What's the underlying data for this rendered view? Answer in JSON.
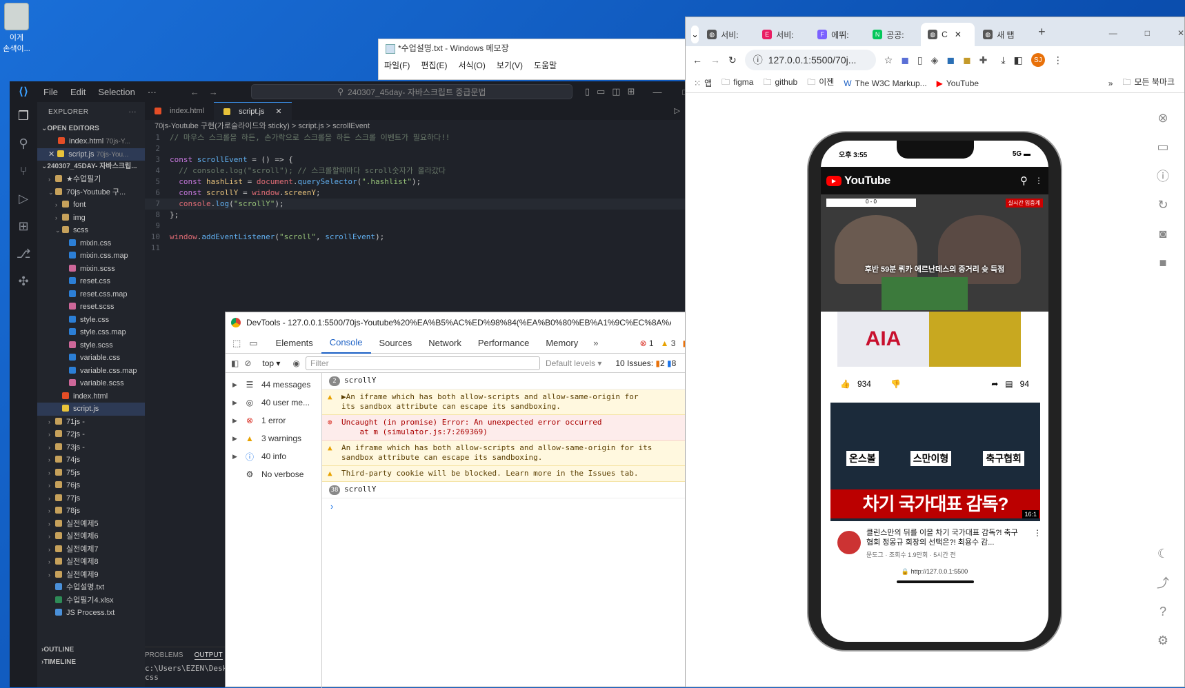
{
  "desktop": {
    "icon_label_1": "이게",
    "icon_label_2": "손색이..."
  },
  "notepad": {
    "title": "*수업설명.txt - Windows 메모장",
    "menu": [
      "파일(F)",
      "편집(E)",
      "서식(O)",
      "보기(V)",
      "도움말"
    ]
  },
  "vscode": {
    "menu": [
      "File",
      "Edit",
      "Selection",
      "···"
    ],
    "search": "240307_45day- 자바스크립트 중급문법",
    "explorer_label": "EXPLORER",
    "open_editors_label": "OPEN EDITORS",
    "open_editors": [
      {
        "name": "index.html",
        "path": "70js-Y..."
      },
      {
        "name": "script.js",
        "path": "70js-You..."
      }
    ],
    "workspace_label": "240307_45DAY- 자바스크립...",
    "tree": [
      {
        "label": "★수업필기",
        "indent": 1,
        "type": "folder"
      },
      {
        "label": "70js-Youtube 구...",
        "indent": 1,
        "type": "folder-open"
      },
      {
        "label": "font",
        "indent": 2,
        "type": "folder"
      },
      {
        "label": "img",
        "indent": 2,
        "type": "folder"
      },
      {
        "label": "scss",
        "indent": 2,
        "type": "folder-open"
      },
      {
        "label": "mixin.css",
        "indent": 3,
        "type": "css"
      },
      {
        "label": "mixin.css.map",
        "indent": 3,
        "type": "css"
      },
      {
        "label": "mixin.scss",
        "indent": 3,
        "type": "scss"
      },
      {
        "label": "reset.css",
        "indent": 3,
        "type": "css"
      },
      {
        "label": "reset.css.map",
        "indent": 3,
        "type": "css"
      },
      {
        "label": "reset.scss",
        "indent": 3,
        "type": "scss"
      },
      {
        "label": "style.css",
        "indent": 3,
        "type": "css"
      },
      {
        "label": "style.css.map",
        "indent": 3,
        "type": "css"
      },
      {
        "label": "style.scss",
        "indent": 3,
        "type": "scss"
      },
      {
        "label": "variable.css",
        "indent": 3,
        "type": "css"
      },
      {
        "label": "variable.css.map",
        "indent": 3,
        "type": "css"
      },
      {
        "label": "variable.scss",
        "indent": 3,
        "type": "scss"
      },
      {
        "label": "index.html",
        "indent": 2,
        "type": "html"
      },
      {
        "label": "script.js",
        "indent": 2,
        "type": "js"
      },
      {
        "label": "71js -",
        "indent": 1,
        "type": "folder"
      },
      {
        "label": "72js -",
        "indent": 1,
        "type": "folder"
      },
      {
        "label": "73js -",
        "indent": 1,
        "type": "folder"
      },
      {
        "label": "74js",
        "indent": 1,
        "type": "folder"
      },
      {
        "label": "75js",
        "indent": 1,
        "type": "folder"
      },
      {
        "label": "76js",
        "indent": 1,
        "type": "folder"
      },
      {
        "label": "77js",
        "indent": 1,
        "type": "folder"
      },
      {
        "label": "78js",
        "indent": 1,
        "type": "folder"
      },
      {
        "label": "실전예제5",
        "indent": 1,
        "type": "folder"
      },
      {
        "label": "실전예제6",
        "indent": 1,
        "type": "folder"
      },
      {
        "label": "실전예제7",
        "indent": 1,
        "type": "folder"
      },
      {
        "label": "실전예제8",
        "indent": 1,
        "type": "folder"
      },
      {
        "label": "실전예제9",
        "indent": 1,
        "type": "folder"
      },
      {
        "label": "수업설명.txt",
        "indent": 1,
        "type": "txt"
      },
      {
        "label": "수업필기4.xlsx",
        "indent": 1,
        "type": "xlsx"
      },
      {
        "label": "JS Process.txt",
        "indent": 1,
        "type": "txt"
      }
    ],
    "outline_label": "OUTLINE",
    "timeline_label": "TIMELINE",
    "tabs": [
      {
        "label": "index.html"
      },
      {
        "label": "script.js"
      }
    ],
    "breadcrumb": "70js-Youtube 구현(가로슬라이드와 sticky) > script.js > scrollEvent",
    "code": [
      {
        "n": "1",
        "html": "<span class='c-cm'>// 마우스 스크롤을 하든, 손가락으로 스크롤을 하든 스크롤 이벤트가 필요하다!!</span>"
      },
      {
        "n": "2",
        "html": ""
      },
      {
        "n": "3",
        "html": "<span class='c-kw'>const</span> <span class='c-fn'>scrollEvent</span> <span class='c-tx'>= () =&gt; {</span>"
      },
      {
        "n": "4",
        "html": "  <span class='c-cm'>// console.log(\"scroll\"); // 스크롤할때마다 scroll숫자가 올라갔다</span>"
      },
      {
        "n": "5",
        "html": "  <span class='c-kw'>const</span> <span class='c-vr'>hashList</span> <span class='c-tx'>= </span><span class='c-id'>document</span><span class='c-tx'>.</span><span class='c-fn'>querySelector</span><span class='c-tx'>(</span><span class='c-st'>\".hashlist\"</span><span class='c-tx'>);</span>"
      },
      {
        "n": "6",
        "html": "  <span class='c-kw'>const</span> <span class='c-vr'>scrollY</span> <span class='c-tx'>= </span><span class='c-id'>window</span><span class='c-tx'>.</span><span class='c-vr'>screenY</span><span class='c-tx'>;</span>"
      },
      {
        "n": "7",
        "html": "  <span class='c-id'>console</span><span class='c-tx'>.</span><span class='c-fn'>log</span><span class='c-tx'>(</span><span class='c-st'>\"scrollY\"</span><span class='c-tx'>);</span>"
      },
      {
        "n": "8",
        "html": "<span class='c-tx'>};</span>"
      },
      {
        "n": "9",
        "html": ""
      },
      {
        "n": "10",
        "html": "<span class='c-id'>window</span><span class='c-tx'>.</span><span class='c-fn'>addEventListener</span><span class='c-tx'>(</span><span class='c-st'>\"scroll\"</span><span class='c-tx'>, </span><span class='c-fn'>scrollEvent</span><span class='c-tx'>);</span>"
      },
      {
        "n": "11",
        "html": ""
      }
    ],
    "panel_tabs": [
      "PROBLEMS",
      "OUTPUT"
    ],
    "panel_path": "c:\\Users\\EZEN\\Desk",
    "panel_text": "css"
  },
  "devtools": {
    "title": "DevTools - 127.0.0.1:5500/70js-Youtube%20%EA%B5%AC%ED%98%84(%EA%B0%80%EB%A1%9C%EC%8A%AC%EB%...",
    "tabs": [
      "Elements",
      "Console",
      "Sources",
      "Network",
      "Performance",
      "Memory"
    ],
    "counts": {
      "errors": "1",
      "warnings": "3",
      "issues": "2"
    },
    "context": "top",
    "filter_placeholder": "Filter",
    "levels": "Default levels",
    "issues_label": "10 Issues:",
    "issues_a": "2",
    "issues_b": "8",
    "side": [
      {
        "label": "44 messages",
        "icon": "list-icon"
      },
      {
        "label": "40 user me...",
        "icon": "user-icon"
      },
      {
        "label": "1 error",
        "icon": "error-icon"
      },
      {
        "label": "3 warnings",
        "icon": "warning-icon"
      },
      {
        "label": "40 info",
        "icon": "info-icon"
      },
      {
        "label": "No verbose",
        "icon": "bug-icon"
      }
    ],
    "messages": [
      {
        "kind": "log",
        "count": "2",
        "text": "scrollY",
        "src": "script.js:7",
        "link": false
      },
      {
        "kind": "w",
        "text": "▶An iframe which has both allow-scripts and allow-same-origin for\nits sandbox attribute can escape its sandboxing.",
        "src": "simulator.js:7",
        "link": true
      },
      {
        "kind": "e",
        "text": "Uncaught (in promise) Error: An unexpected error occurred\n    at m (simulator.js:7:269369)",
        "src": "simulator.js:7",
        "link": false
      },
      {
        "kind": "w",
        "text": "An iframe which has both allow-scripts and allow-same-origin for its\nsandbox attribute can escape its sandboxing.",
        "src": "index.html:1",
        "link": true
      },
      {
        "kind": "w",
        "text": "Third-party cookie will be blocked. Learn more in the Issues tab.",
        "src": "index.html:1",
        "link": true
      },
      {
        "kind": "log",
        "count": "38",
        "text": "scrollY",
        "src": "script.js:7",
        "link": true
      }
    ],
    "prompt": "›"
  },
  "browser": {
    "tabs": [
      {
        "label": "서비:",
        "icon": "globe"
      },
      {
        "label": "서비:",
        "icon": "E"
      },
      {
        "label": "에뛰:",
        "icon": "F"
      },
      {
        "label": "공공:",
        "icon": "N"
      },
      {
        "label": "C",
        "icon": "globe"
      },
      {
        "label": "새 탭",
        "icon": "globe"
      }
    ],
    "url": "127.0.0.1:5500/70j...",
    "bookmarks": [
      "앱",
      "figma",
      "github",
      "이젠",
      "The W3C Markup...",
      "YouTube"
    ],
    "all_bookmarks": "모든 북마크",
    "avatar": "SJ"
  },
  "phone": {
    "time": "오후 3:55",
    "signal": "5G",
    "brand": "YouTube",
    "video1_overlay": "후반 59분 뤼카 에르난데스의 중거리 슛 득점",
    "video1_tag": "실시간 입중계",
    "score": "0 - 0",
    "likes": "934",
    "comments": "94",
    "thumb2_labels": [
      "온스볼",
      "스만이형",
      "축구협회"
    ],
    "thumb2_headline": "차기 국가대표 감독?",
    "duration": "16:1",
    "video2_title": "클린스만의 뒤를 이을 차기 국가대표 감독?! 축구협회 정몽규 회장의 선택은?! 최용수 감...",
    "video2_meta": "문도그 · 조회수 1.9만회 · 5시간 전",
    "footer_url": "http://127.0.0.1:5500",
    "colors": {
      "yt_red": "#ff0000",
      "black": "#0f0f0f"
    }
  }
}
